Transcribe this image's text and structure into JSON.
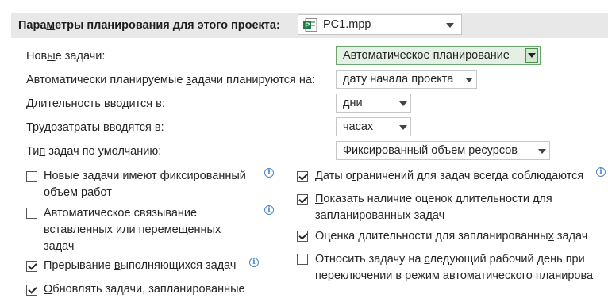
{
  "header": {
    "label_before": "Пара",
    "label_under": "м",
    "label_after": "етры планирования для этого проекта:",
    "project_file": "PC1.mpp"
  },
  "rows": [
    {
      "label_before": "Нов",
      "label_under": "ы",
      "label_after": "е задачи:",
      "value": "Автоматическое планирование"
    },
    {
      "label_before": "Автоматически планируемые ",
      "label_under": "з",
      "label_after": "адачи планируются на:",
      "value": "дату начала проекта"
    },
    {
      "label_before": "",
      "label_under": "Д",
      "label_after": "лительность вводится в:",
      "value": "дни"
    },
    {
      "label_before": "",
      "label_under": "Т",
      "label_after": "рудозатраты вводятся в:",
      "value": "часах"
    },
    {
      "label_before": "Ти",
      "label_under": "п",
      "label_after": " задач по умолчанию:",
      "value": "Фиксированный объем ресурсов"
    }
  ],
  "left_options": [
    {
      "checked": false,
      "line1_before": "Новые задачи имеют фиксированный",
      "line1_under": "",
      "line1_after": "",
      "line2": "объем работ",
      "line3": ""
    },
    {
      "checked": false,
      "line1_before": "Автоматическое связывание",
      "line1_under": "",
      "line1_after": "",
      "line2": "вставленных или перемещенных",
      "line3": "задач"
    },
    {
      "checked": true,
      "line1_before": "Прерывание ",
      "line1_under": "в",
      "line1_after": "ыполняющихся задач",
      "line2": "",
      "line3": ""
    },
    {
      "checked": true,
      "line1_before": "",
      "line1_under": "О",
      "line1_after": "бновлять задачи, запланированные",
      "line2": "",
      "line3": ""
    }
  ],
  "right_options": [
    {
      "checked": true,
      "line1_before": "Даты о",
      "line1_under": "г",
      "line1_after": "раничений для задач всегда соблюдаются",
      "line2": ""
    },
    {
      "checked": true,
      "line1_before": "",
      "line1_under": "П",
      "line1_after": "оказать наличие оценок длительности для",
      "line2": "запланированных задач"
    },
    {
      "checked": true,
      "line1_before": "Оценка длительности для запланированны",
      "line1_under": "х",
      "line1_after": " задач",
      "line2": ""
    },
    {
      "checked": false,
      "line1_before": "Относить задачу на ",
      "line1_under": "с",
      "line1_after": "ледующий рабочий день при",
      "line2": "переключении в режим автоматического планирова"
    }
  ],
  "icons": {
    "project": "project-file-icon",
    "info": "info-icon",
    "dropdown": "chevron-down-icon"
  },
  "colors": {
    "header_bg": "#e8e8e8",
    "active_combo": "#e3f0e3",
    "active_border": "#6aa66a",
    "project_icon": "#1f7a43",
    "info": "#4a86c8"
  }
}
